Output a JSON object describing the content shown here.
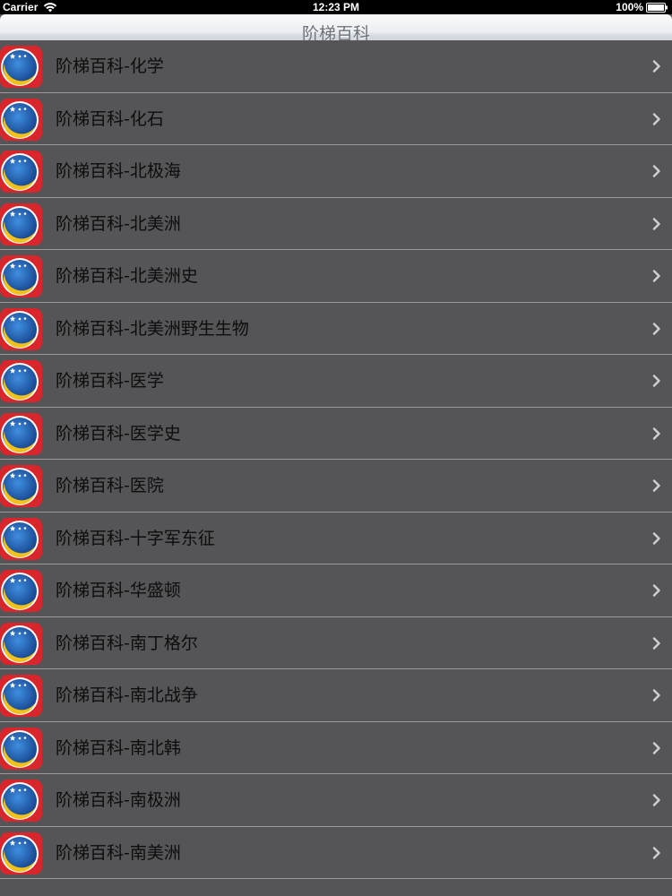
{
  "status_bar": {
    "carrier": "Carrier",
    "time": "12:23 PM",
    "battery": "100%"
  },
  "nav": {
    "title": "阶梯百科"
  },
  "list": {
    "items": [
      {
        "label": "阶梯百科-化学"
      },
      {
        "label": "阶梯百科-化石"
      },
      {
        "label": "阶梯百科-北极海"
      },
      {
        "label": "阶梯百科-北美洲"
      },
      {
        "label": "阶梯百科-北美洲史"
      },
      {
        "label": "阶梯百科-北美洲野生生物"
      },
      {
        "label": "阶梯百科-医学"
      },
      {
        "label": "阶梯百科-医学史"
      },
      {
        "label": "阶梯百科-医院"
      },
      {
        "label": "阶梯百科-十字军东征"
      },
      {
        "label": "阶梯百科-华盛顿"
      },
      {
        "label": "阶梯百科-南丁格尔"
      },
      {
        "label": "阶梯百科-南北战争"
      },
      {
        "label": "阶梯百科-南北韩"
      },
      {
        "label": "阶梯百科-南极洲"
      },
      {
        "label": "阶梯百科-南美洲"
      }
    ],
    "row_icon": "moon-stars-icon",
    "accessory_icon": "chevron-right-icon"
  },
  "colors": {
    "row_background": "#555456",
    "separator": "#9a9a9c",
    "label_text": "#0d0d0d",
    "nav_title": "#6c7179",
    "icon_blue": "#1f5fb3",
    "icon_moon": "#f2c21b",
    "icon_red": "#d8262c"
  }
}
